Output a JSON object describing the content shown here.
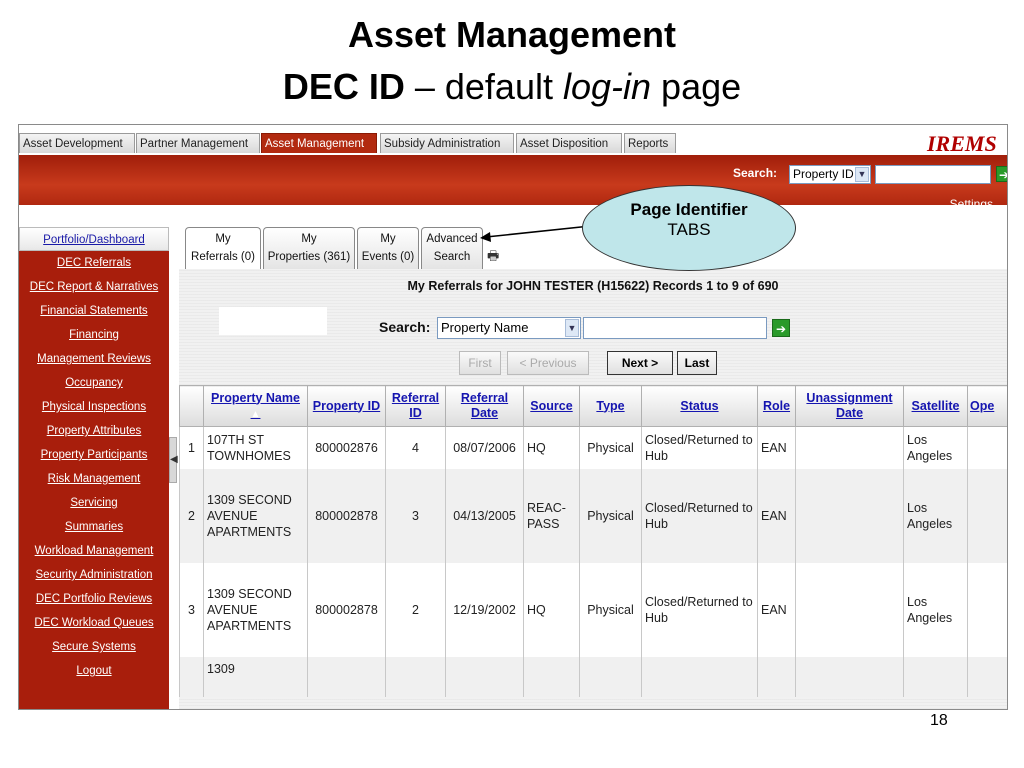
{
  "slide": {
    "title": "Asset Management",
    "subtitle_bold": "DEC ID",
    "subtitle_dash": " – default ",
    "subtitle_italic": "log-in",
    "subtitle_end": " page",
    "page_number": "18"
  },
  "topnav": {
    "tabs": [
      "Asset Development",
      "Partner Management",
      "Asset Management",
      "Subsidy Administration",
      "Asset Disposition",
      "Reports"
    ],
    "active": "Asset Management",
    "logo": "IREMS"
  },
  "header": {
    "search_label": "Search:",
    "search_select": "Property ID",
    "settings": "Settings"
  },
  "sidebar": {
    "items": [
      "Portfolio/Dashboard",
      "DEC Referrals",
      "DEC Report & Narratives",
      "Financial Statements",
      "Financing",
      "Management Reviews",
      "Occupancy",
      "Physical Inspections",
      "Property Attributes",
      "Property Participants",
      "Risk Management",
      "Servicing",
      "Summaries",
      "Workload Management",
      "Security Administration",
      "DEC Portfolio Reviews",
      "DEC Workload Queues",
      "Secure Systems",
      "Logout"
    ]
  },
  "content_tabs": [
    {
      "l1": "My",
      "l2": "Referrals (0)"
    },
    {
      "l1": "My",
      "l2": "Properties (361)"
    },
    {
      "l1": "My",
      "l2": "Events (0)"
    },
    {
      "l1": "Advanced",
      "l2": "Search"
    }
  ],
  "records_text": "My Referrals for  JOHN TESTER   (H15622) Records 1 to 9 of 690",
  "search2": {
    "label": "Search:",
    "select": "Property Name"
  },
  "pager": {
    "first": "First",
    "previous": "< Previous",
    "next": "Next >",
    "last": "Last"
  },
  "table": {
    "headers": [
      "",
      "Property Name",
      "Property ID",
      "Referral ID",
      "Referral Date",
      "Source",
      "Type",
      "Status",
      "Role",
      "Unassignment Date",
      "Satellite",
      "Ope"
    ],
    "rows": [
      [
        "1",
        "107TH ST TOWNHOMES",
        "800002876",
        "4",
        "08/07/2006",
        "HQ",
        "Physical",
        "Closed/Returned to Hub",
        "EAN",
        "",
        "Los Angeles",
        ""
      ],
      [
        "2",
        "1309 SECOND AVENUE APARTMENTS",
        "800002878",
        "3",
        "04/13/2005",
        "REAC-PASS",
        "Physical",
        "Closed/Returned to Hub",
        "EAN",
        "",
        "Los Angeles",
        ""
      ],
      [
        "3",
        "1309 SECOND AVENUE APARTMENTS",
        "800002878",
        "2",
        "12/19/2002",
        "HQ",
        "Physical",
        "Closed/Returned to Hub",
        "EAN",
        "",
        "Los Angeles",
        ""
      ],
      [
        "",
        "1309",
        "",
        "",
        "",
        "",
        "",
        "",
        "",
        "",
        "",
        ""
      ]
    ]
  },
  "callout": {
    "line1": "Page Identifier",
    "line2": "TABS"
  }
}
